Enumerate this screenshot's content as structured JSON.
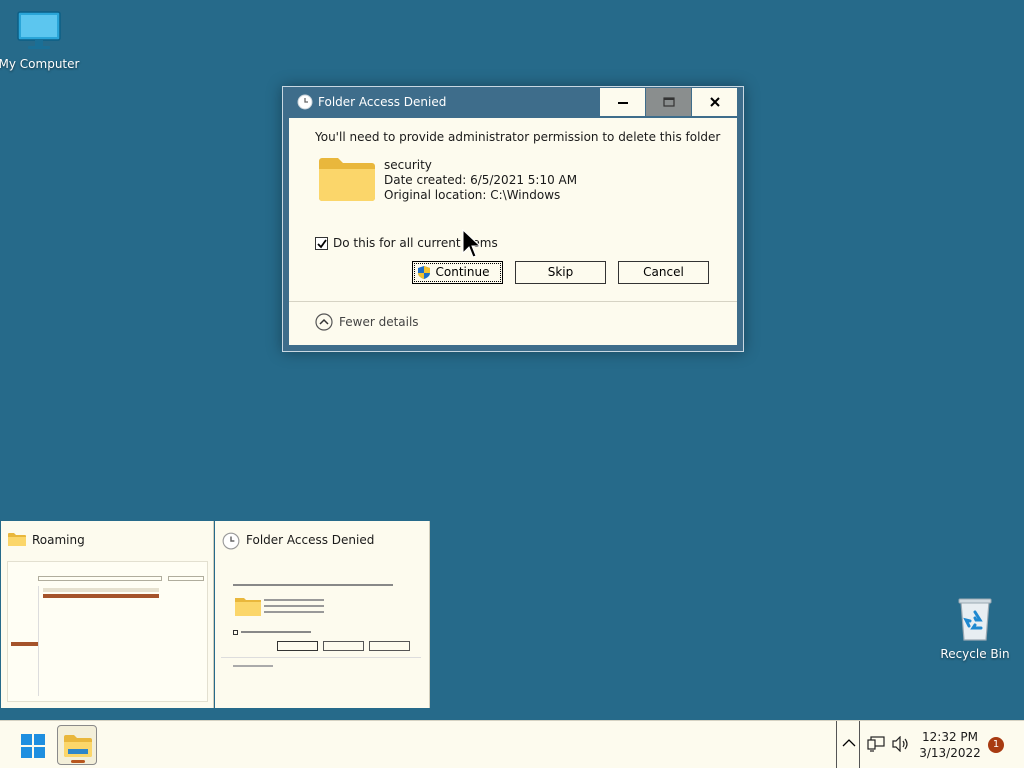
{
  "desktop": {
    "my_computer_label": "My Computer",
    "recycle_bin_label": "Recycle Bin"
  },
  "dialog": {
    "title": "Folder Access Denied",
    "message": "You'll need to provide administrator permission to delete this folder",
    "item": {
      "name": "security",
      "date_created": "Date created: 6/5/2021 5:10 AM",
      "original_location": "Original location: C:\\Windows"
    },
    "apply_all_label": "Do this for all current items",
    "apply_all_checked": true,
    "buttons": {
      "continue": "Continue",
      "skip": "Skip",
      "cancel": "Cancel"
    },
    "fewer_details": "Fewer details"
  },
  "thumbnails": [
    {
      "title": "Roaming"
    },
    {
      "title": "Folder Access Denied"
    }
  ],
  "taskbar": {
    "time": "12:32 PM",
    "date": "3/13/2022",
    "notification_count": "1"
  },
  "colors": {
    "desktop": "#266a8a",
    "title_bar": "#3e6d8b",
    "window_bg": "#fdfbee"
  }
}
